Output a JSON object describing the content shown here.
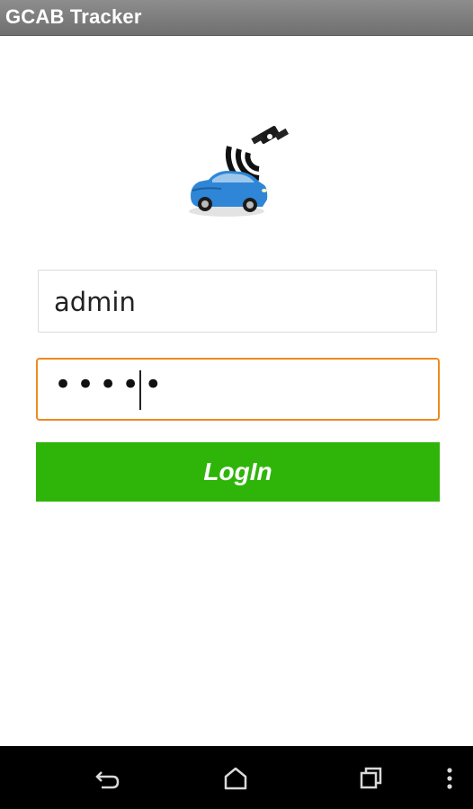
{
  "app_bar": {
    "title": "GCAB Tracker"
  },
  "logo": {
    "icon": "car-gps-signal-icon",
    "car_color": "#2f86d6"
  },
  "form": {
    "username_value": "admin",
    "password_masked": "•••••"
  },
  "login_button": {
    "label": "LogIn",
    "color": "#2fb50a"
  },
  "nav_bar": {
    "back_icon": "back-icon",
    "home_icon": "home-icon",
    "recents_icon": "recents-icon",
    "menu_icon": "overflow-menu-icon"
  }
}
